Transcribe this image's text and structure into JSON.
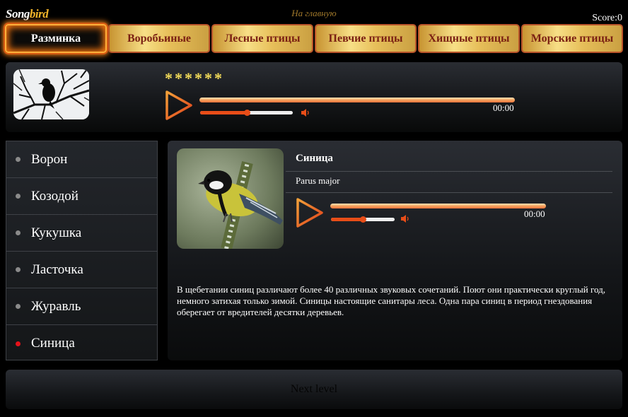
{
  "header": {
    "logo_part1": "Song",
    "logo_part2": "bird",
    "home_link": "На главную",
    "score": "Score:0"
  },
  "tabs": [
    {
      "label": "Разминка",
      "active": true
    },
    {
      "label": "Воробьиные",
      "active": false
    },
    {
      "label": "Лесные птицы",
      "active": false
    },
    {
      "label": "Певчие птицы",
      "active": false
    },
    {
      "label": "Хищные птицы",
      "active": false
    },
    {
      "label": "Морские птицы",
      "active": false
    }
  ],
  "question": {
    "hidden_name": "******",
    "player": {
      "time": "00:00",
      "volume_fraction": 0.5
    }
  },
  "birds": [
    {
      "name": "Ворон",
      "status": "neutral"
    },
    {
      "name": "Козодой",
      "status": "neutral"
    },
    {
      "name": "Кукушка",
      "status": "neutral"
    },
    {
      "name": "Ласточка",
      "status": "neutral"
    },
    {
      "name": "Журавль",
      "status": "neutral"
    },
    {
      "name": "Синица",
      "status": "wrong"
    }
  ],
  "detail": {
    "name": "Синица",
    "latin": "Parus major",
    "player": {
      "time": "00:00",
      "volume_fraction": 0.5
    },
    "description": "В щебетании синиц различают более 40 различных звуковых сочетаний. Поют они практически круглый год, немного затихая только зимой. Синицы настоящие санитары леса. Одна пара синиц в период гнездования оберегает от вредителей десятки деревьев."
  },
  "next_level": "Next level",
  "colors": {
    "accent_orange": "#e84d18",
    "tab_text": "#7a1f12",
    "stars": "#f4dd5a",
    "wrong_dot": "#e5121a"
  }
}
